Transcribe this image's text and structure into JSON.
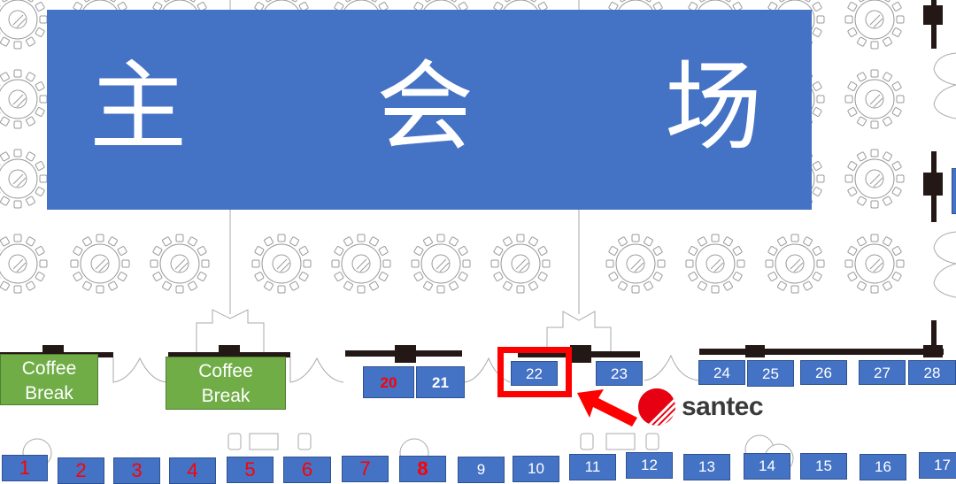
{
  "venue": {
    "main_hall_title": [
      "主",
      "会",
      "场"
    ],
    "highlight_color": "#ff0000",
    "booth_color": "#4472c4",
    "coffee_color": "#70ad47"
  },
  "coffee_breaks": [
    {
      "line1": "Coffee",
      "line2": "Break"
    },
    {
      "line1": "Coffee",
      "line2": "Break"
    }
  ],
  "booths_upper": [
    {
      "label": "20",
      "style": "boldred"
    },
    {
      "label": "21",
      "style": "bold"
    },
    {
      "label": "22",
      "style": "normal",
      "highlighted": true
    },
    {
      "label": "23",
      "style": "normal"
    },
    {
      "label": "24",
      "style": "normal"
    },
    {
      "label": "25",
      "style": "normal"
    },
    {
      "label": "26",
      "style": "normal"
    },
    {
      "label": "27",
      "style": "normal"
    },
    {
      "label": "28",
      "style": "normal"
    }
  ],
  "booths_lower": [
    {
      "label": "1",
      "style": "red"
    },
    {
      "label": "2",
      "style": "red"
    },
    {
      "label": "3",
      "style": "red"
    },
    {
      "label": "4",
      "style": "red"
    },
    {
      "label": "5",
      "style": "red"
    },
    {
      "label": "6",
      "style": "red"
    },
    {
      "label": "7",
      "style": "red"
    },
    {
      "label": "8",
      "style": "boldred"
    },
    {
      "label": "9",
      "style": "normal"
    },
    {
      "label": "10",
      "style": "normal"
    },
    {
      "label": "11",
      "style": "normal"
    },
    {
      "label": "12",
      "style": "normal"
    },
    {
      "label": "13",
      "style": "normal"
    },
    {
      "label": "14",
      "style": "normal"
    },
    {
      "label": "15",
      "style": "normal"
    },
    {
      "label": "16",
      "style": "normal"
    },
    {
      "label": "17",
      "style": "normal"
    }
  ],
  "exhibitor": {
    "name": "santec",
    "logo_icon": "santec-logo-icon",
    "booth": "22"
  }
}
